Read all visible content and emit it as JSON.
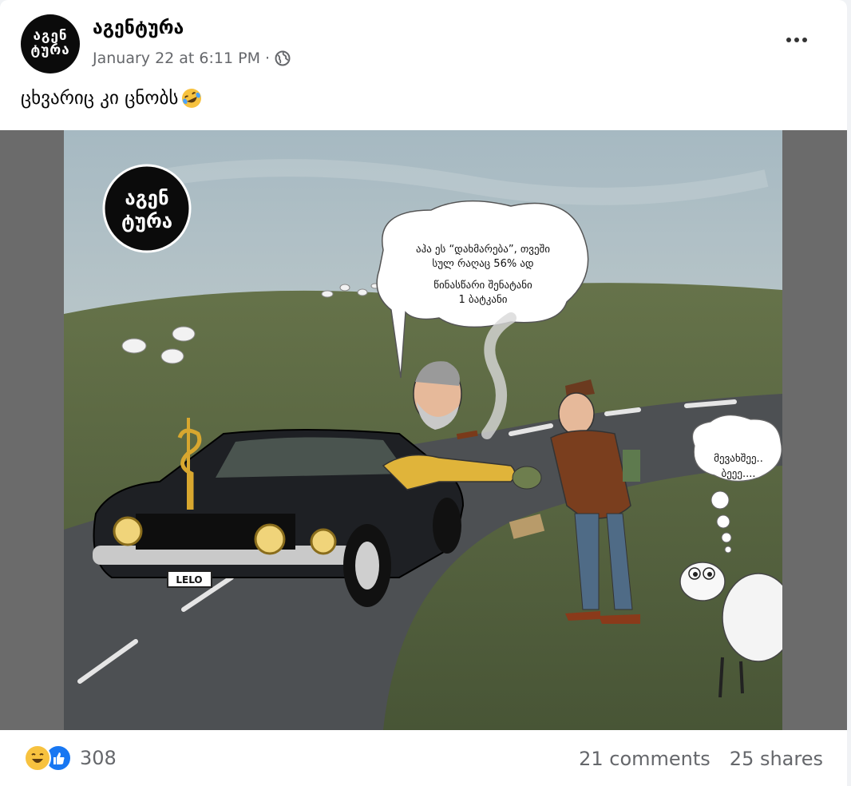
{
  "post": {
    "page_name": "აგენტურა",
    "timestamp": "January 22 at 6:11 PM",
    "separator": "·",
    "privacy_icon": "globe-icon",
    "caption": "ცხვარიც კი ცნობს",
    "caption_emoji": "rofl-emoji-icon",
    "avatar_logo_line1": "აგენ",
    "avatar_logo_line2": "ტურა"
  },
  "comic": {
    "logo_line1": "აგენ",
    "logo_line2": "ტურა",
    "speech_line1": "აჰა ეს “დახმარება”, თვეში",
    "speech_line2": "სულ რაღაც 56% ად",
    "speech_line3": "წინასწარი შენატანი",
    "speech_line4": "1 ბატკანი",
    "sheep_line1": "მევახშეე..",
    "sheep_line2": "ბეეე....",
    "plate": "LELO"
  },
  "footer": {
    "reaction_icons": [
      "haha-icon",
      "like-icon"
    ],
    "reaction_count": "308",
    "comments": "21 comments",
    "shares": "25 shares"
  },
  "colors": {
    "sky": "#9fb3bd",
    "field": "#5b6a43",
    "road": "#4c4f52",
    "car": "#1e2024",
    "meta_text": "#65676b",
    "like_blue": "#1877f2",
    "haha_yellow": "#f7c23f"
  }
}
